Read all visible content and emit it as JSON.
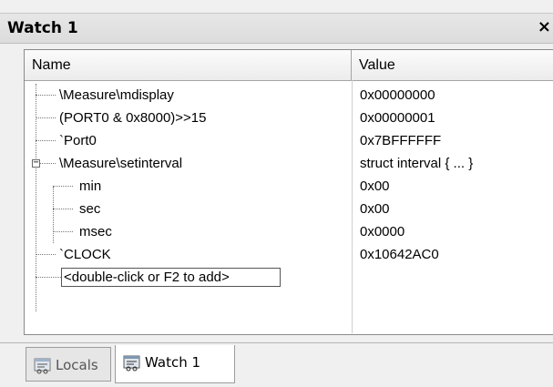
{
  "window": {
    "title": "Watch 1",
    "close_glyph": "×"
  },
  "table": {
    "columns": {
      "name": "Name",
      "value": "Value"
    },
    "rows": [
      {
        "name": "\\Measure\\mdisplay",
        "value": "0x00000000"
      },
      {
        "name": "(PORT0 & 0x8000)>>15",
        "value": "0x00000001"
      },
      {
        "name": "`Port0",
        "value": "0x7BFFFFFF"
      },
      {
        "name": "\\Measure\\setinterval",
        "value": "struct interval { ... }",
        "expanded": true,
        "expander_glyph": "−"
      },
      {
        "name": "min",
        "value": "0x00"
      },
      {
        "name": "sec",
        "value": "0x00"
      },
      {
        "name": "msec",
        "value": "0x0000"
      },
      {
        "name": "`CLOCK",
        "value": "0x10642AC0"
      }
    ],
    "add_placeholder": "<double-click or F2 to add>"
  },
  "tabs": [
    {
      "label": "Locals",
      "icon": "watch-window-icon",
      "active": false
    },
    {
      "label": "Watch 1",
      "icon": "watch-window-icon",
      "active": true
    }
  ]
}
